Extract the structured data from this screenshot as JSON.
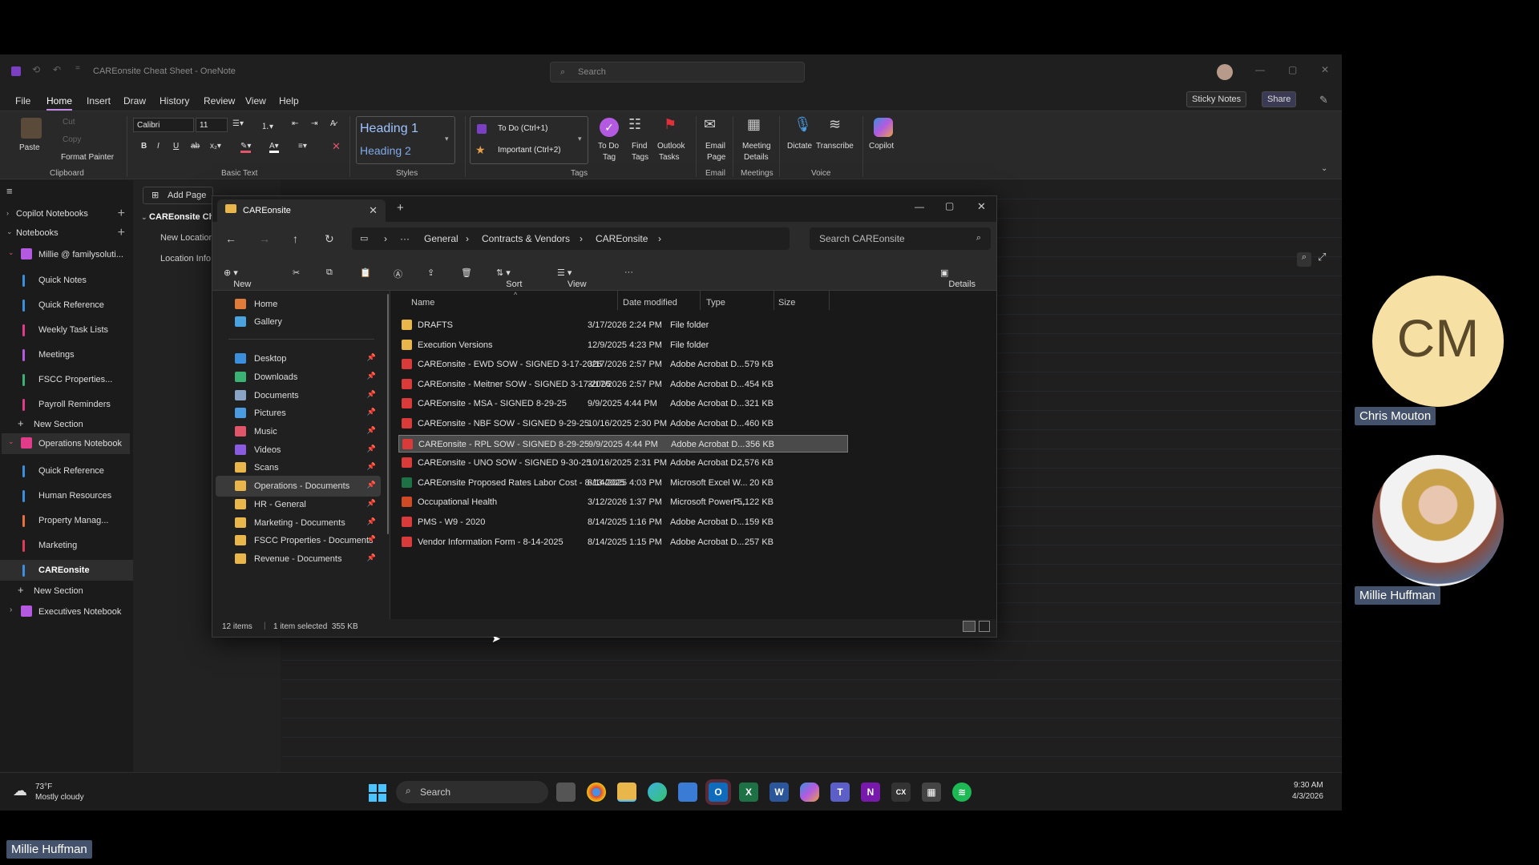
{
  "onenote": {
    "title": "CAREonsite Cheat Sheet - OneNote",
    "search_placeholder": "Search",
    "menu": [
      "File",
      "Home",
      "Insert",
      "Draw",
      "History",
      "Review",
      "View",
      "Help"
    ],
    "sticky_notes": "Sticky Notes",
    "share": "Share",
    "ribbon": {
      "paste": "Paste",
      "cut": "Cut",
      "copy": "Copy",
      "format_painter": "Format Painter",
      "clipboard": "Clipboard",
      "font": "Calibri",
      "size": "11",
      "basic_text": "Basic Text",
      "heading1": "Heading 1",
      "heading2": "Heading 2",
      "styles": "Styles",
      "todo": "To Do (Ctrl+1)",
      "important": "Important (Ctrl+2)",
      "todo_tag_1": "To Do",
      "todo_tag_2": "Tag",
      "find_tags_1": "Find",
      "find_tags_2": "Tags",
      "outlook_tasks_1": "Outlook",
      "outlook_tasks_2": "Tasks",
      "tags": "Tags",
      "email_page_1": "Email",
      "email_page_2": "Page",
      "email": "Email",
      "meeting_details_1": "Meeting",
      "meeting_details_2": "Details",
      "meetings": "Meetings",
      "dictate": "Dictate",
      "transcribe": "Transcribe",
      "voice": "Voice",
      "copilot": "Copilot"
    },
    "nav": {
      "copilot_notebooks": "Copilot Notebooks",
      "notebooks": "Notebooks",
      "notebook1": "Millie @ familysoluti...",
      "sections1": [
        "Quick Notes",
        "Quick Reference",
        "Weekly Task Lists",
        "Meetings",
        "FSCC Properties...",
        "Payroll Reminders"
      ],
      "new_section": "New Section",
      "notebook2": "Operations Notebook",
      "sections2": [
        "Quick Reference",
        "Human Resources",
        "Property Manag...",
        "Marketing",
        "CAREonsite"
      ],
      "notebook3": "Executives Notebook"
    },
    "pages": {
      "add_page": "Add Page",
      "section_title": "CAREonsite Che",
      "items": [
        "New Location",
        "Location Info"
      ]
    }
  },
  "explorer": {
    "tab_title": "CAREonsite",
    "breadcrumb": [
      "General",
      "Contracts & Vendors",
      "CAREonsite"
    ],
    "search_placeholder": "Search CAREonsite",
    "commands": {
      "new": "New",
      "sort": "Sort",
      "view": "View",
      "details": "Details"
    },
    "sidebar": [
      {
        "label": "Home",
        "color": "#e07b39",
        "pinned": false
      },
      {
        "label": "Gallery",
        "color": "#4aa3df",
        "pinned": false
      },
      {
        "label": "Desktop",
        "color": "#3c8fdc",
        "pinned": true
      },
      {
        "label": "Downloads",
        "color": "#3bb273",
        "pinned": true
      },
      {
        "label": "Documents",
        "color": "#8aa4c8",
        "pinned": true
      },
      {
        "label": "Pictures",
        "color": "#4a9be0",
        "pinned": true
      },
      {
        "label": "Music",
        "color": "#e0556a",
        "pinned": true
      },
      {
        "label": "Videos",
        "color": "#8a5be0",
        "pinned": true
      },
      {
        "label": "Scans",
        "color": "#e8b64a",
        "pinned": true
      },
      {
        "label": "Operations - Documents",
        "color": "#e8b64a",
        "pinned": true
      },
      {
        "label": "HR - General",
        "color": "#e8b64a",
        "pinned": true
      },
      {
        "label": "Marketing - Documents",
        "color": "#e8b64a",
        "pinned": true
      },
      {
        "label": "FSCC Properties - Documents",
        "color": "#e8b64a",
        "pinned": true
      },
      {
        "label": "Revenue - Documents",
        "color": "#e8b64a",
        "pinned": true
      }
    ],
    "columns": [
      "Name",
      "Date modified",
      "Type",
      "Size"
    ],
    "files": [
      {
        "name": "DRAFTS",
        "date": "3/17/2026 2:24 PM",
        "type": "File folder",
        "size": "",
        "kind": "folder"
      },
      {
        "name": "Execution Versions",
        "date": "12/9/2025 4:23 PM",
        "type": "File folder",
        "size": "",
        "kind": "folder"
      },
      {
        "name": "CAREonsite - EWD SOW - SIGNED 3-17-2026",
        "date": "3/17/2026 2:57 PM",
        "type": "Adobe Acrobat D...",
        "size": "579 KB",
        "kind": "pdf"
      },
      {
        "name": "CAREonsite - Meitner SOW - SIGNED 3-17-2026",
        "date": "3/17/2026 2:57 PM",
        "type": "Adobe Acrobat D...",
        "size": "454 KB",
        "kind": "pdf"
      },
      {
        "name": "CAREonsite - MSA - SIGNED 8-29-25",
        "date": "9/9/2025 4:44 PM",
        "type": "Adobe Acrobat D...",
        "size": "321 KB",
        "kind": "pdf"
      },
      {
        "name": "CAREonsite - NBF SOW - SIGNED 9-29-25",
        "date": "10/16/2025 2:30 PM",
        "type": "Adobe Acrobat D...",
        "size": "460 KB",
        "kind": "pdf"
      },
      {
        "name": "CAREonsite - RPL SOW - SIGNED 8-29-25",
        "date": "9/9/2025 4:44 PM",
        "type": "Adobe Acrobat D...",
        "size": "356 KB",
        "kind": "pdf"
      },
      {
        "name": "CAREonsite - UNO SOW - SIGNED 9-30-25",
        "date": "10/16/2025 2:31 PM",
        "type": "Adobe Acrobat D...",
        "size": "2,576 KB",
        "kind": "pdf"
      },
      {
        "name": "CAREonsite Proposed Rates  Labor Cost - 8-13-2025",
        "date": "8/14/2025 4:03 PM",
        "type": "Microsoft Excel W...",
        "size": "20 KB",
        "kind": "xlsx"
      },
      {
        "name": "Occupational Health",
        "date": "3/12/2026 1:37 PM",
        "type": "Microsoft PowerP...",
        "size": "5,122 KB",
        "kind": "pptx"
      },
      {
        "name": "PMS - W9 - 2020",
        "date": "8/14/2025 1:16 PM",
        "type": "Adobe Acrobat D...",
        "size": "159 KB",
        "kind": "pdf"
      },
      {
        "name": "Vendor Information Form - 8-14-2025",
        "date": "8/14/2025 1:15 PM",
        "type": "Adobe Acrobat D...",
        "size": "257 KB",
        "kind": "pdf"
      }
    ],
    "selected_index": 6,
    "status": {
      "items": "12 items",
      "selected": "1 item selected  355 KB"
    }
  },
  "taskbar": {
    "weather_temp": "73°F",
    "weather_desc": "Mostly cloudy",
    "search": "Search",
    "time": "9:30 AM",
    "date": "4/3/2026"
  },
  "meeting": {
    "p1_initials": "CM",
    "p1_name": "Chris Mouton",
    "p2_name": "Millie Huffman",
    "self_name": "Millie Huffman"
  }
}
